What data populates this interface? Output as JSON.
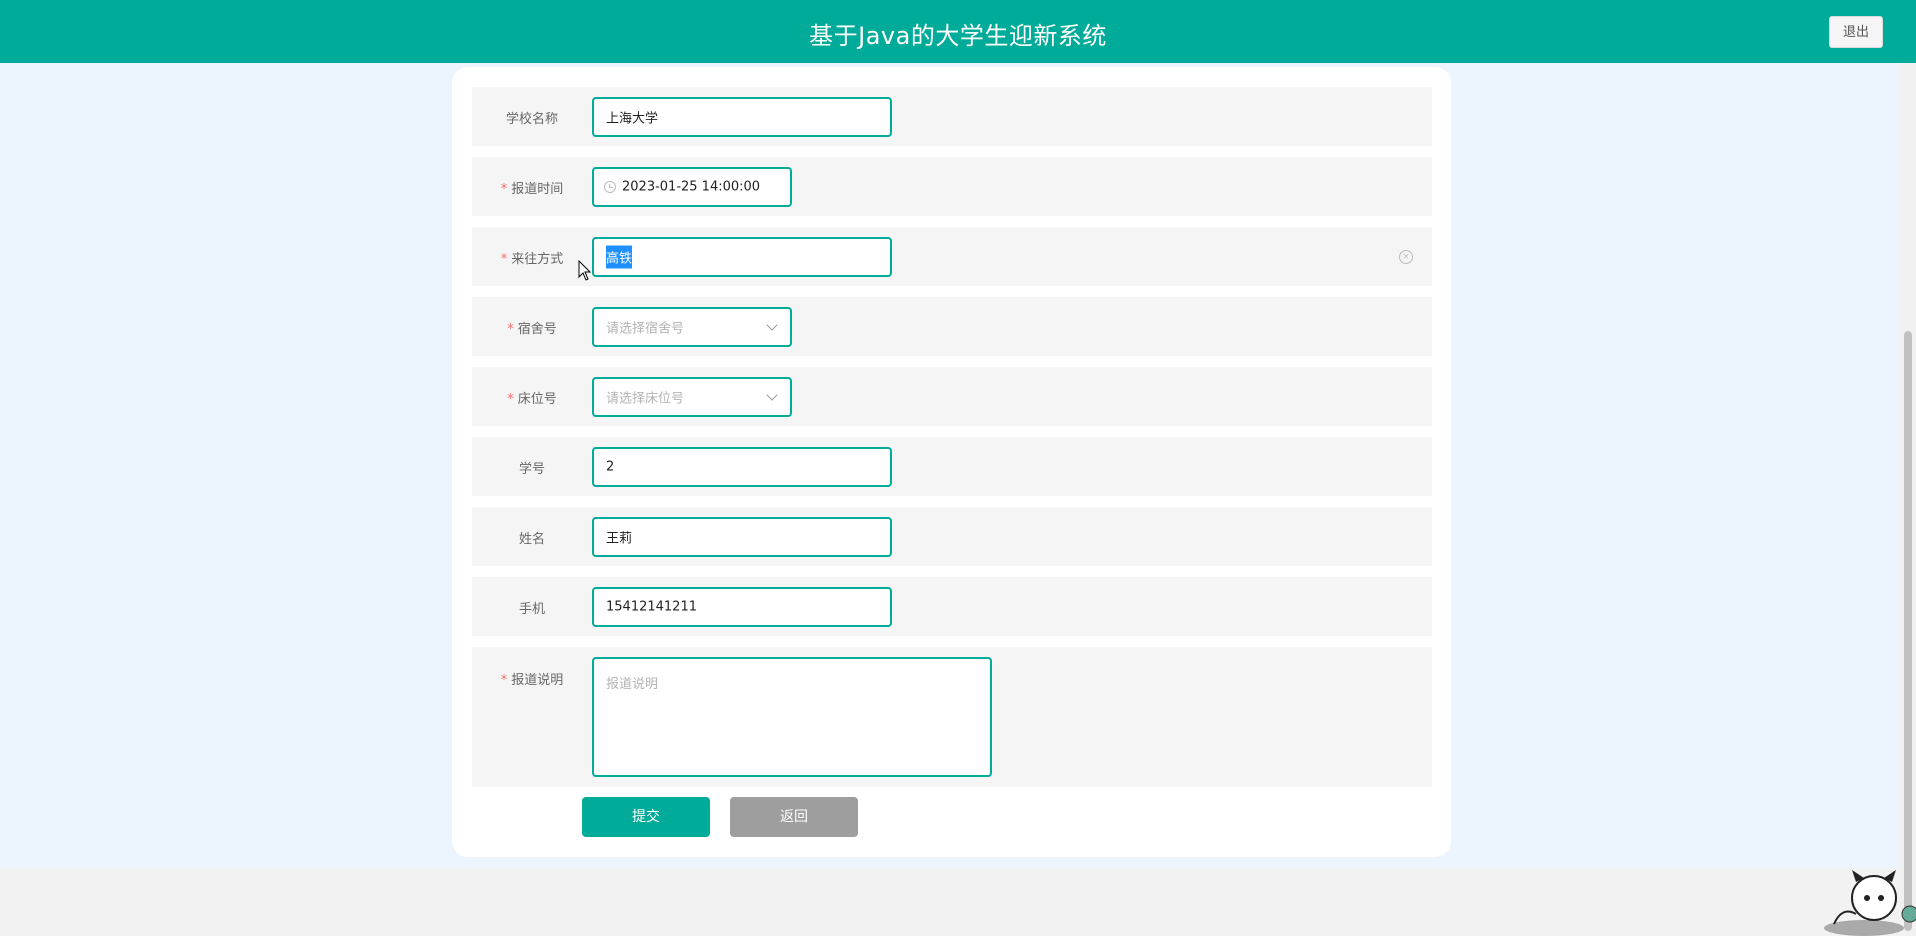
{
  "header": {
    "title": "基于Java的大学生迎新系统",
    "logout_label": "退出"
  },
  "form": {
    "school": {
      "label": "学校名称",
      "value": "上海大学"
    },
    "report_time": {
      "required": "*",
      "label": "报道时间",
      "value": "2023-01-25 14:00:00"
    },
    "travel": {
      "required": "*",
      "label": "来往方式",
      "value": "高铁"
    },
    "dorm": {
      "required": "*",
      "label": "宿舍号",
      "placeholder": "请选择宿舍号"
    },
    "bed": {
      "required": "*",
      "label": "床位号",
      "placeholder": "请选择床位号"
    },
    "student_id": {
      "label": "学号",
      "value": "2"
    },
    "name": {
      "label": "姓名",
      "value": "王莉"
    },
    "phone": {
      "label": "手机",
      "value": "15412141211"
    },
    "description": {
      "required": "*",
      "label": "报道说明",
      "placeholder": "报道说明"
    }
  },
  "actions": {
    "submit_label": "提交",
    "back_label": "返回"
  },
  "icons": {
    "clock": "clock-icon",
    "clear": "circle-close-icon",
    "chevron": "chevron-down-icon",
    "cursor": "mouse-pointer-icon",
    "mascot": "cat-mascot-icon"
  },
  "colors": {
    "accent": "#00ab9a",
    "required": "#f56c6c",
    "background": "#ecf5fd",
    "back_button": "#9e9e9e"
  }
}
